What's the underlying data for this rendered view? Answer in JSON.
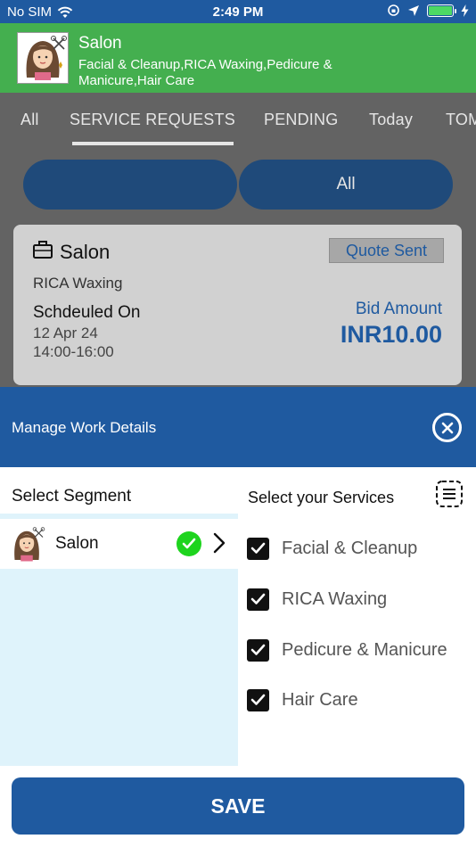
{
  "status_bar": {
    "carrier": "No SIM",
    "time": "2:49 PM"
  },
  "header": {
    "title": "Salon",
    "subtitle": "Facial & Cleanup,RICA Waxing,Pedicure & Manicure,Hair Care"
  },
  "tabs": [
    {
      "label": "All"
    },
    {
      "label": "SERVICE REQUESTS"
    },
    {
      "label": "PENDING"
    },
    {
      "label": "Today"
    },
    {
      "label": "TOM"
    }
  ],
  "filter": {
    "left_label": "",
    "right_label": "All"
  },
  "request_card": {
    "title": "Salon",
    "status": "Quote Sent",
    "service": "RICA Waxing",
    "scheduled_label": "Schdeuled On",
    "date": "12 Apr 24",
    "time": "14:00-16:00",
    "bid_label": "Bid Amount",
    "bid_amount": "INR10.00"
  },
  "sheet": {
    "title": "Manage Work Details",
    "segment_heading": "Select Segment",
    "services_heading": "Select your Services",
    "segments": [
      {
        "label": "Salon",
        "selected": true
      }
    ],
    "services": [
      {
        "label": "Facial & Cleanup",
        "checked": true
      },
      {
        "label": "RICA Waxing",
        "checked": true
      },
      {
        "label": "Pedicure & Manicure",
        "checked": true
      },
      {
        "label": "Hair Care",
        "checked": true
      }
    ],
    "save_label": "SAVE"
  },
  "colors": {
    "primary": "#1f5aa0",
    "header_green": "#44af4f",
    "check_green": "#1ed41e",
    "segment_bg": "#dff3fb"
  }
}
